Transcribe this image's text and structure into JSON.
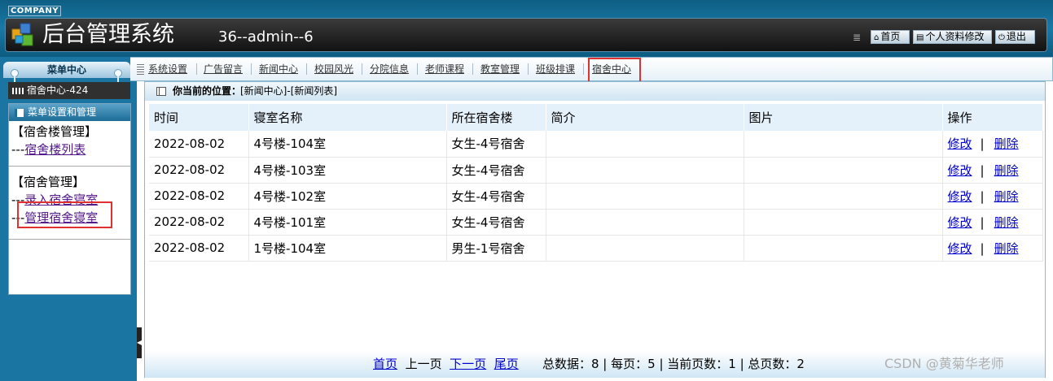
{
  "header": {
    "company": "COMPANY",
    "title": "后台管理系统",
    "user_info": "36--admin--6",
    "buttons": {
      "home": "首页",
      "profile": "个人资料修改",
      "logout": "退出"
    }
  },
  "sidebar": {
    "menu_center": "菜单中心",
    "active_item": "宿舍中心-424",
    "panel_title": "菜单设置和管理",
    "groups": [
      {
        "title": "【宿舍楼管理】",
        "links": [
          "宿舍楼列表"
        ]
      },
      {
        "title": "【宿舍管理】",
        "links": [
          "录入宿舍寝室",
          "管理宿舍寝室"
        ]
      }
    ],
    "link_prefix": "---"
  },
  "topnav": {
    "items": [
      "系统设置",
      "广告留言",
      "新闻中心",
      "校园风光",
      "分院信息",
      "老师课程",
      "教室管理",
      "班级排课",
      "宿舍中心"
    ],
    "active": "宿舍中心"
  },
  "breadcrumb": {
    "label": "你当前的位置：",
    "path": "[新闻中心]-[新闻列表]"
  },
  "table": {
    "headers": [
      "时间",
      "寝室名称",
      "所在宿舍楼",
      "简介",
      "图片",
      "操作"
    ],
    "rows": [
      {
        "time": "2022-08-02",
        "room": "4号楼-104室",
        "building": "女生-4号宿舍",
        "intro": "",
        "image": ""
      },
      {
        "time": "2022-08-02",
        "room": "4号楼-103室",
        "building": "女生-4号宿舍",
        "intro": "",
        "image": ""
      },
      {
        "time": "2022-08-02",
        "room": "4号楼-102室",
        "building": "女生-4号宿舍",
        "intro": "",
        "image": ""
      },
      {
        "time": "2022-08-02",
        "room": "4号楼-101室",
        "building": "女生-4号宿舍",
        "intro": "",
        "image": ""
      },
      {
        "time": "2022-08-02",
        "room": "1号楼-104室",
        "building": "男生-1号宿舍",
        "intro": "",
        "image": ""
      }
    ],
    "edit_label": "修改",
    "delete_label": "删除",
    "action_sep": "|"
  },
  "pager": {
    "first": "首页",
    "prev": "上一页",
    "next": "下一页",
    "last": "尾页",
    "stats": "总数据：8 | 每页：5 | 当前页数：1 | 总页数：2"
  },
  "watermark": "CSDN @黄菊华老师",
  "colors": {
    "header_blue": "#1979a6",
    "link_blue": "#0000cc",
    "highlight_red": "#e03030",
    "table_header_bg": "#e5f1fa"
  }
}
